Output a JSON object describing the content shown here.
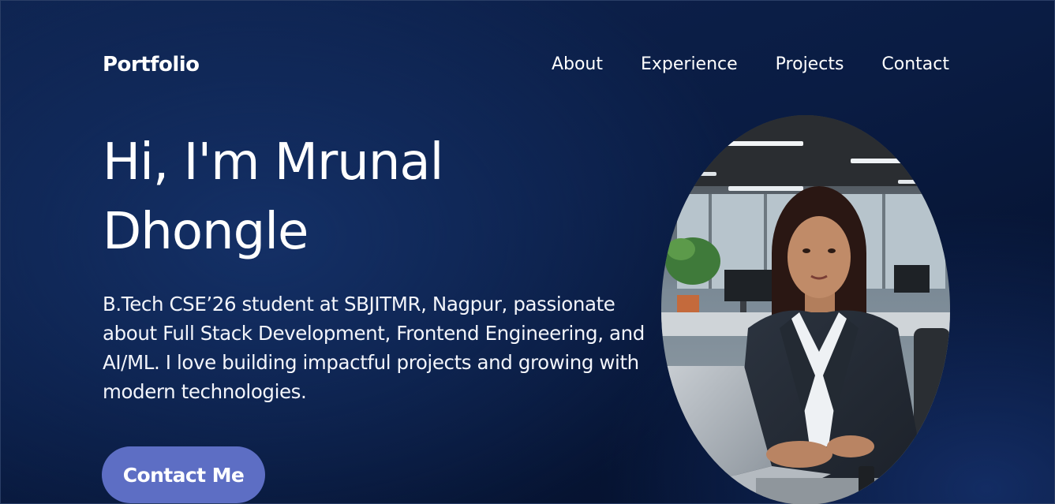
{
  "header": {
    "logo": "Portfolio",
    "nav": [
      {
        "label": "About"
      },
      {
        "label": "Experience"
      },
      {
        "label": "Projects"
      },
      {
        "label": "Contact"
      }
    ]
  },
  "hero": {
    "title_line1": "Hi, I'm Mrunal",
    "title_line2": "Dhongle",
    "description": "B.Tech CSE’26 student at SBJITMR, Nagpur, passionate about Full Stack Development, Frontend Engineering, and AI/ML. I love building impactful projects and growing with modern technologies.",
    "cta_label": "Contact Me"
  },
  "colors": {
    "background": "#0b1d45",
    "button": "#5d6ec4",
    "text": "#ffffff"
  }
}
